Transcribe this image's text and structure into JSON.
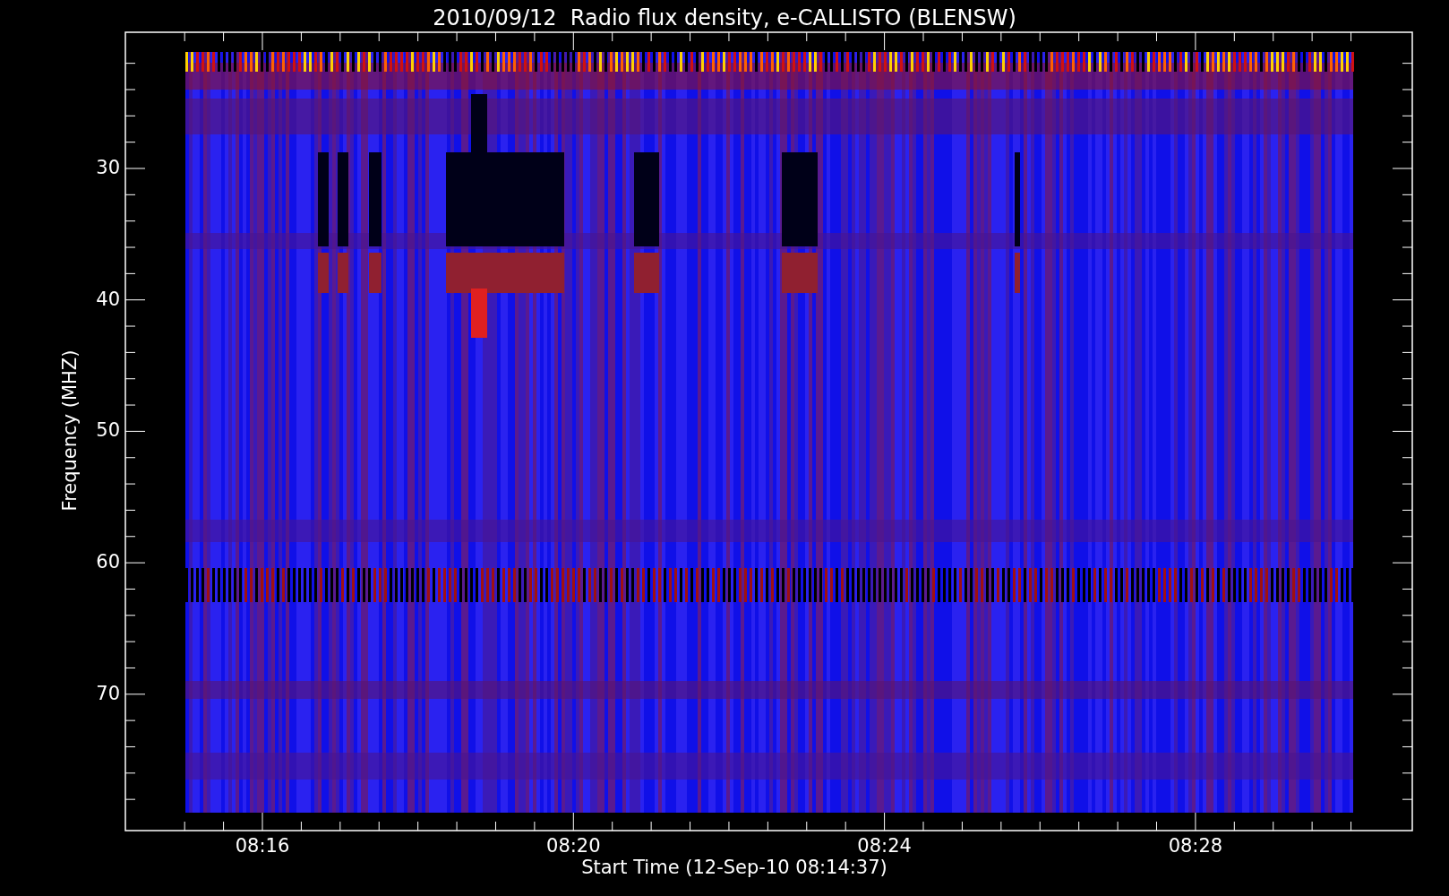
{
  "title": "2010/09/12  Radio flux density, e-CALLISTO (BLENSW)",
  "ylabel": "Frequency (MHZ)",
  "xlabel": "Start Time (12-Sep-10 08:14:37)",
  "yticks": [
    "30",
    "40",
    "50",
    "60",
    "70"
  ],
  "xticks": [
    "08:16",
    "08:20",
    "08:24",
    "08:28"
  ]
}
